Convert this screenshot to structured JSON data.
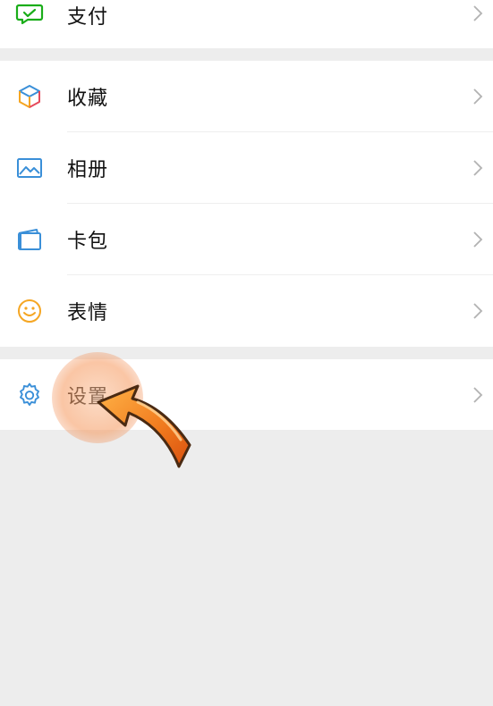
{
  "menu": {
    "pay": {
      "label": "支付",
      "icon": "wallet-check-icon",
      "color": "#1aad19"
    },
    "favorites": {
      "label": "收藏",
      "icon": "cube-icon"
    },
    "album": {
      "label": "相册",
      "icon": "photo-icon",
      "color": "#3a8fd8"
    },
    "cards": {
      "label": "卡包",
      "icon": "card-wallet-icon",
      "color": "#3a8fd8"
    },
    "stickers": {
      "label": "表情",
      "icon": "smiley-icon",
      "color": "#f5a623"
    },
    "settings": {
      "label": "设置",
      "icon": "gear-icon",
      "color": "#3a8fd8"
    }
  },
  "colors": {
    "background": "#ededed",
    "row": "#ffffff",
    "text": "#111111",
    "chevron": "#b2b2b2",
    "pointer": "#f07a1e"
  }
}
